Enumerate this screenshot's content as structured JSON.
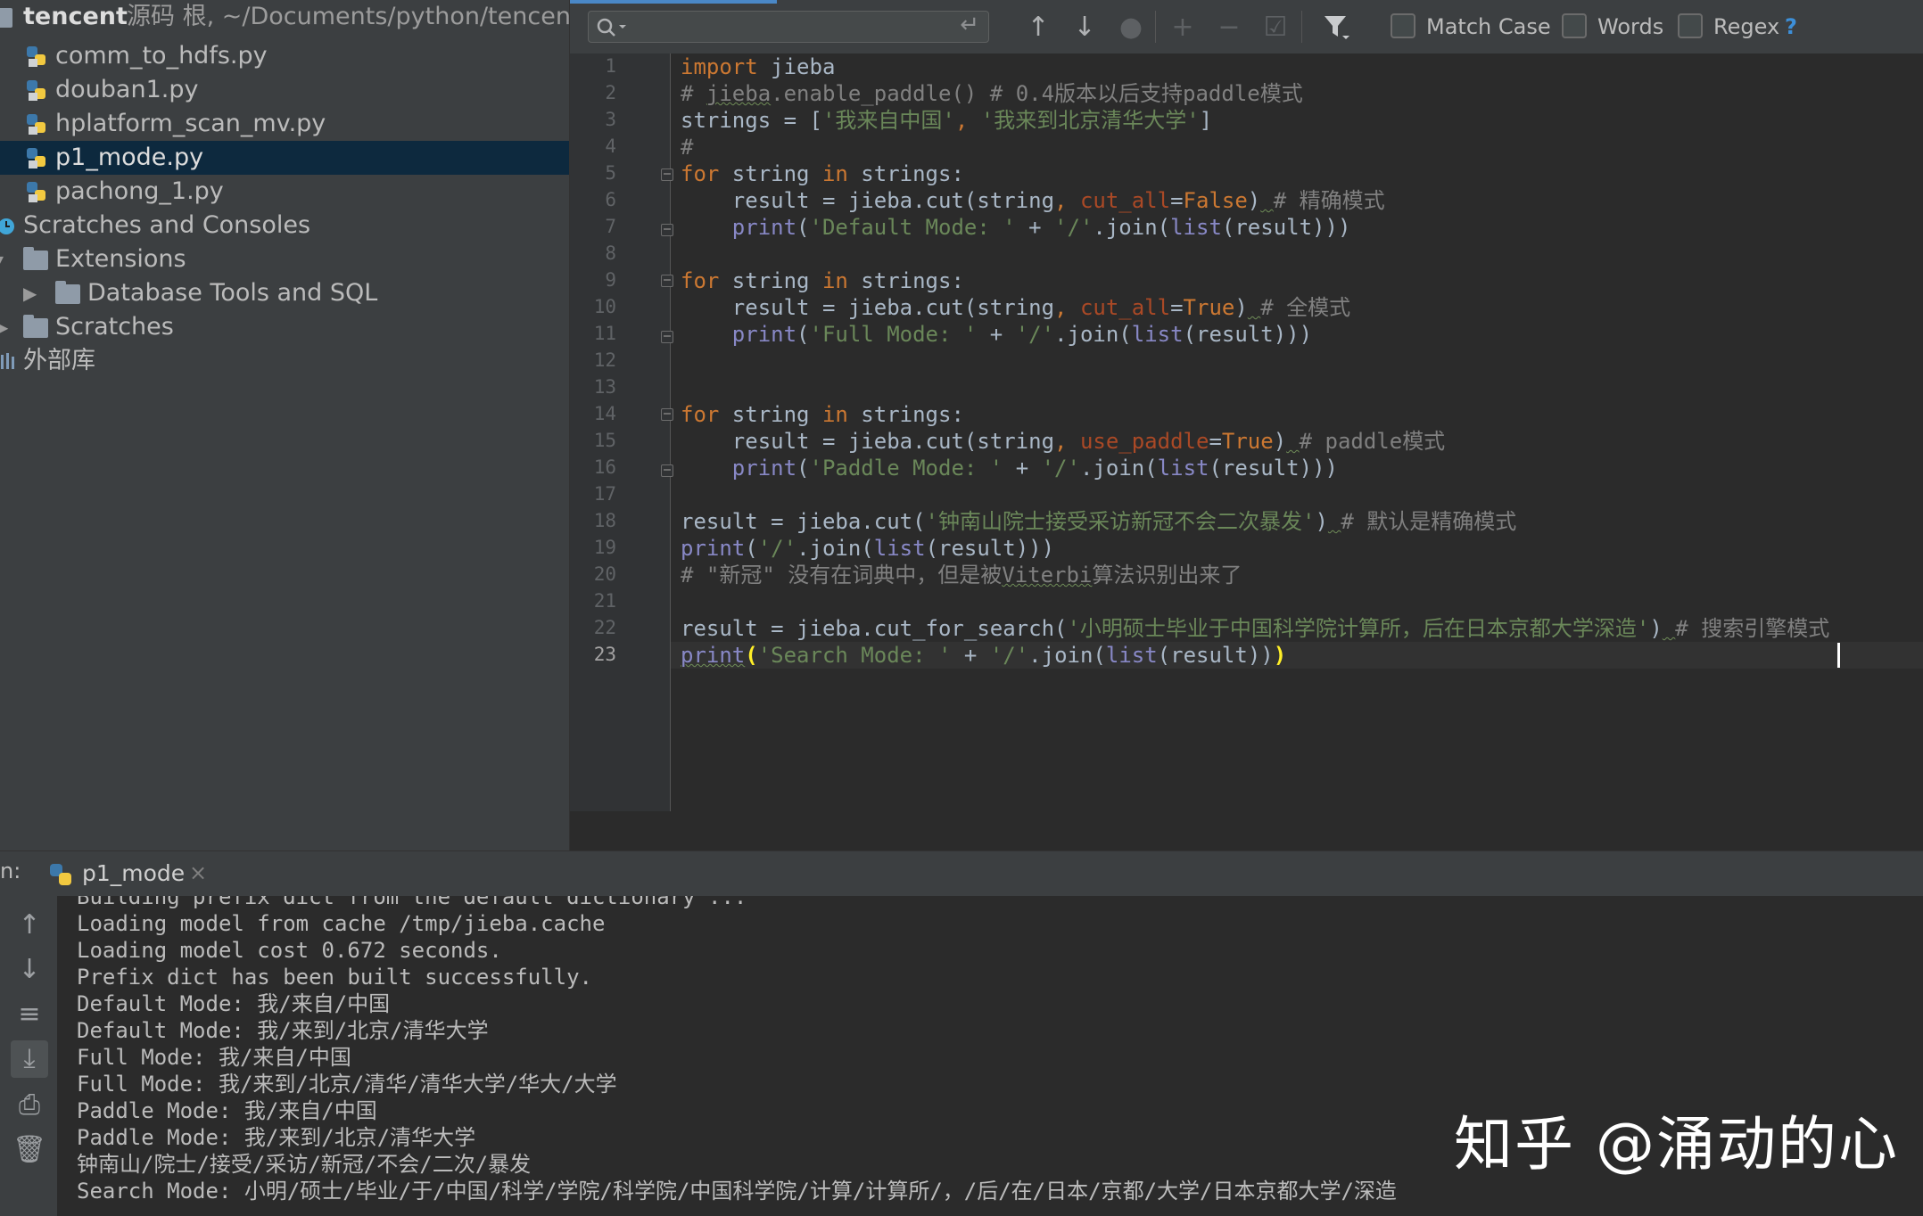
{
  "project_tree": {
    "root": {
      "name": "tencent",
      "path": "源码 根, ~/Documents/python/tencent"
    },
    "files": [
      {
        "label": "comm_to_hdfs.py"
      },
      {
        "label": "douban1.py"
      },
      {
        "label": "hplatform_scan_mv.py"
      },
      {
        "label": "p1_mode.py",
        "selected": true
      },
      {
        "label": "pachong_1.py"
      }
    ],
    "scratches_and_consoles": "Scratches and Consoles",
    "extensions": "Extensions",
    "database_tools": "Database Tools and SQL",
    "scratches": "Scratches",
    "external_libs": "外部库"
  },
  "find_bar": {
    "search_value": "",
    "options": [
      {
        "label": "Match Case",
        "checked": false
      },
      {
        "label": "Words",
        "checked": false
      },
      {
        "label": "Regex",
        "checked": false
      }
    ],
    "help": "?"
  },
  "editor": {
    "current_line": 23,
    "line_numbers": [
      "1",
      "2",
      "3",
      "4",
      "5",
      "6",
      "7",
      "8",
      "9",
      "10",
      "11",
      "12",
      "13",
      "14",
      "15",
      "16",
      "17",
      "18",
      "19",
      "20",
      "21",
      "22",
      "23"
    ]
  },
  "run_panel": {
    "prefix": "n:",
    "tab_label": "p1_mode",
    "output": [
      "Building prefix dict from the default dictionary ...",
      "Loading model from cache /tmp/jieba.cache",
      "Loading model cost 0.672 seconds.",
      "Prefix dict has been built successfully.",
      "Default Mode: 我/来自/中国",
      "Default Mode: 我/来到/北京/清华大学",
      "Full Mode: 我/来自/中国",
      "Full Mode: 我/来到/北京/清华/清华大学/华大/大学",
      "Paddle Mode: 我/来自/中国",
      "Paddle Mode: 我/来到/北京/清华大学",
      "钟南山/院士/接受/采访/新冠/不会/二次/暴发",
      "Search Mode: 小明/硕士/毕业/于/中国/科学/学院/科学院/中国科学院/计算/计算所/，/后/在/日本/京都/大学/日本京都大学/深造"
    ]
  },
  "watermark": "知乎 @涌动的心",
  "colors": {
    "keyword": "#cc7832",
    "string": "#6a8759",
    "comment": "#808080",
    "builtin": "#8888c6",
    "kwarg": "#aa4926",
    "selection": "#0d293e"
  }
}
